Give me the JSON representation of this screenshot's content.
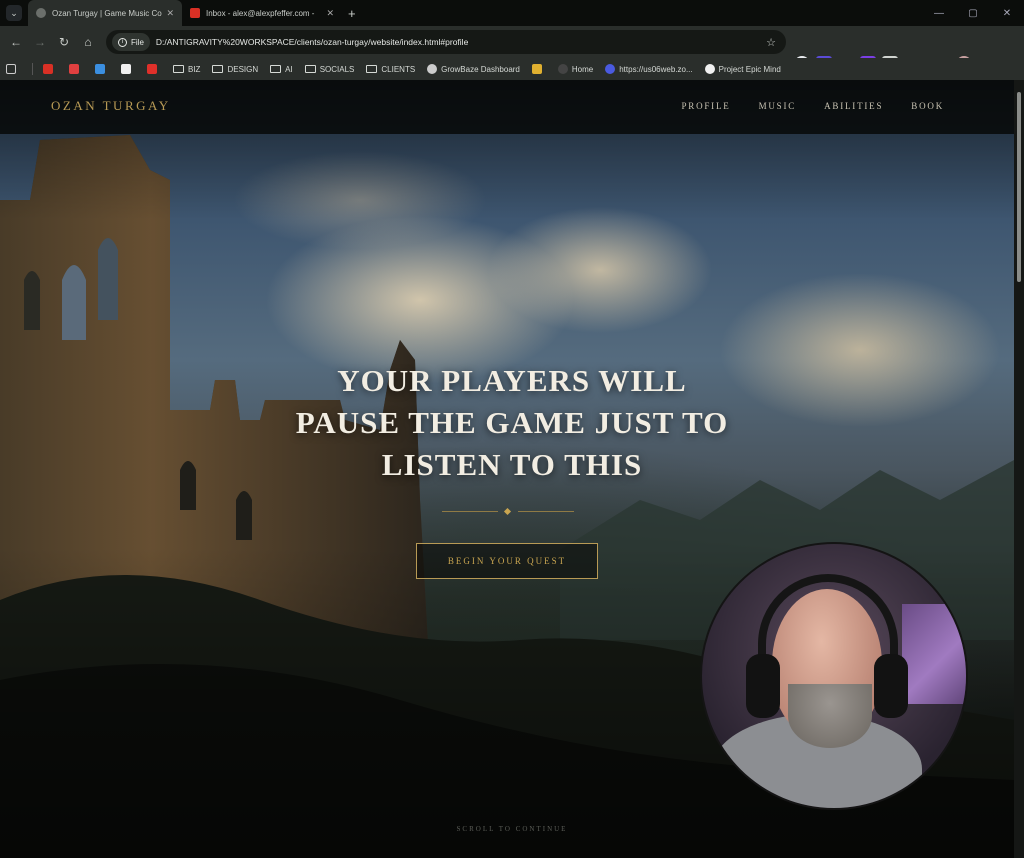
{
  "browser": {
    "tabs": [
      {
        "title": "Ozan Turgay | Game Music Com",
        "active": true
      },
      {
        "title": "Inbox - alex@alexpfeffer.com -",
        "active": false
      }
    ],
    "new_tab_label": "+",
    "address": {
      "chip_label": "File",
      "url": "D:/ANTIGRAVITY%20WORKSPACE/clients/ozan-turgay/website/index.html#profile"
    },
    "bookmarks": [
      {
        "label": "BIZ",
        "type": "folder"
      },
      {
        "label": "DESIGN",
        "type": "folder"
      },
      {
        "label": "AI",
        "type": "folder"
      },
      {
        "label": "SOCIALS",
        "type": "folder"
      },
      {
        "label": "CLIENTS",
        "type": "folder"
      },
      {
        "label": "GrowBaze Dashboard",
        "type": "link"
      },
      {
        "label": "Home",
        "type": "link"
      },
      {
        "label": "https://us06web.zo...",
        "type": "link"
      },
      {
        "label": "Project Epic Mind",
        "type": "link"
      }
    ]
  },
  "site": {
    "logo": "OZAN TURGAY",
    "nav": [
      "PROFILE",
      "MUSIC",
      "ABILITIES",
      "BOOK"
    ],
    "headline_lines": [
      "YOUR PLAYERS WILL",
      "PAUSE THE GAME JUST TO",
      "LISTEN TO THIS"
    ],
    "cta_label": "BEGIN YOUR QUEST",
    "scroll_hint": "SCROLL TO CONTINUE"
  },
  "colors": {
    "accent_gold": "#b89a55",
    "headline": "#f2ede2",
    "chrome_bg": "#2a2e2b"
  }
}
